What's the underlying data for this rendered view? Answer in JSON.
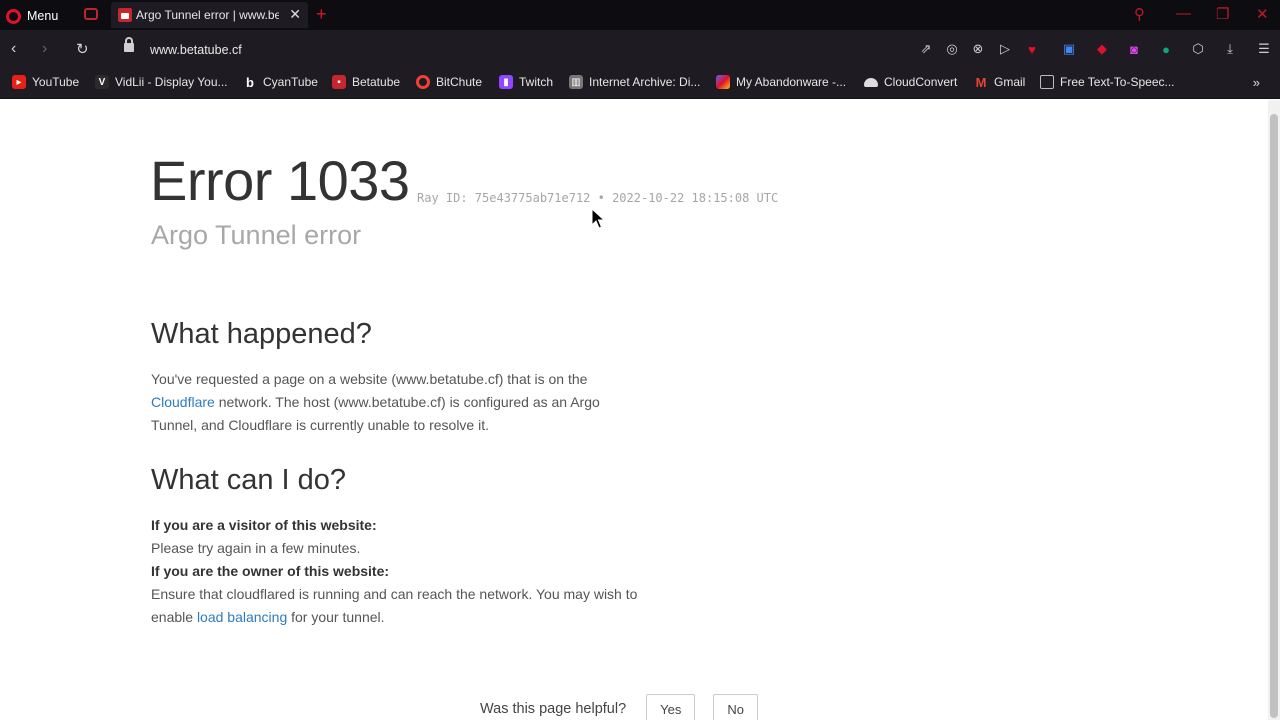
{
  "browser": {
    "menu_label": "Menu",
    "tab_title": "Argo Tunnel error | www.betatube.cf",
    "url": "www.betatube.cf",
    "accent_color": "#e0112d",
    "bookmarks": [
      {
        "label": "YouTube",
        "icon": "youtube-icon",
        "color": "#e62117"
      },
      {
        "label": "VidLii - Display You...",
        "icon": "vidlii-icon",
        "color": "#2b2b2b"
      },
      {
        "label": "CyanTube",
        "icon": "cyantube-icon",
        "color": "#1e1c22"
      },
      {
        "label": "Betatube",
        "icon": "betatube-icon",
        "color": "#c6262e"
      },
      {
        "label": "BitChute",
        "icon": "bitchute-icon",
        "color": "#ef4136"
      },
      {
        "label": "Twitch",
        "icon": "twitch-icon",
        "color": "#9146ff"
      },
      {
        "label": "Internet Archive: Di...",
        "icon": "archive-icon",
        "color": "#777777"
      },
      {
        "label": "My Abandonware -...",
        "icon": "abandonware-icon",
        "color": "#5865f2"
      },
      {
        "label": "CloudConvert",
        "icon": "cloud-icon",
        "color": "#dddddd"
      },
      {
        "label": "Gmail",
        "icon": "gmail-icon",
        "color": "#ea4335"
      },
      {
        "label": "Free Text-To-Speec...",
        "icon": "tts-icon",
        "color": "#888888"
      }
    ]
  },
  "error": {
    "code": "Error 1033",
    "ray_id": "Ray ID: 75e43775ab71e712 • 2022-10-22 18:15:08 UTC",
    "subtitle": "Argo Tunnel error"
  },
  "what_happened": {
    "heading": "What happened?",
    "text_1": "You've requested a page on a website (www.betatube.cf) that is on the",
    "link": "Cloudflare",
    "text_2": " network. The host (www.betatube.cf) is configured as an Argo Tunnel, and Cloudflare is currently unable to resolve it."
  },
  "what_can_i_do": {
    "heading": "What can I do?",
    "visitor_label": "If you are a visitor of this website:",
    "visitor_text": "Please try again in a few minutes.",
    "owner_label": "If you are the owner of this website:",
    "owner_text_1": "Ensure that cloudflared is running and can reach the network. You may wish to enable ",
    "owner_link": "load balancing",
    "owner_text_2": " for your tunnel."
  },
  "feedback": {
    "question": "Was this page helpful?",
    "yes": "Yes",
    "no": "No"
  }
}
